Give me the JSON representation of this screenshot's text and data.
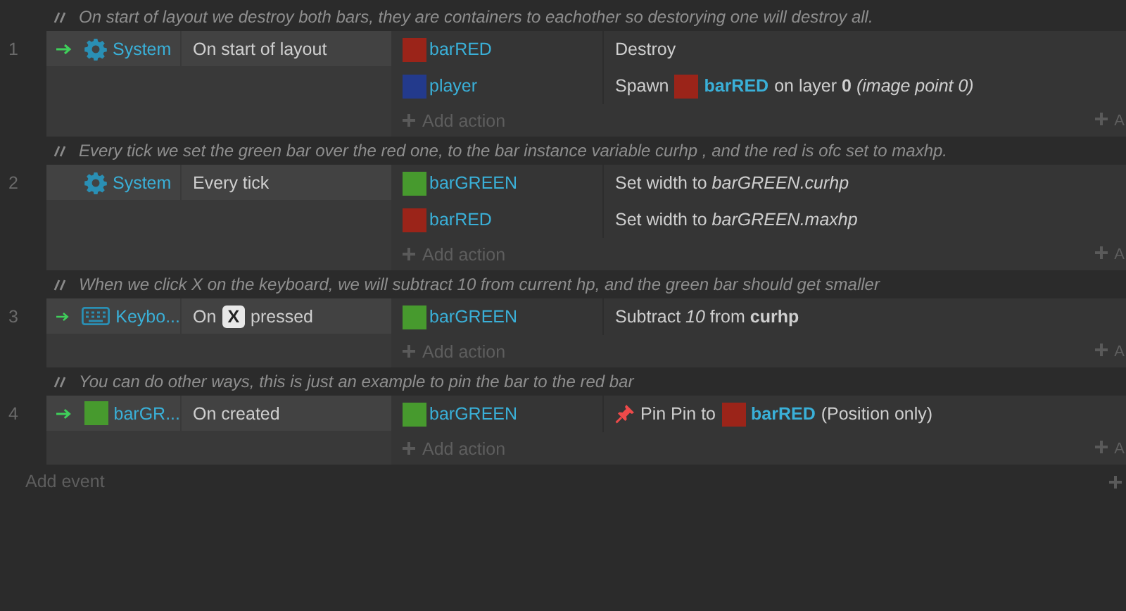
{
  "events": [
    {
      "number": "1",
      "comment": "On start of layout we destroy both bars, they are containers to eachother so destorying one will destroy all.",
      "condition": {
        "trigger": true,
        "object": {
          "kind": "system",
          "name": "System"
        },
        "parts": [
          {
            "kind": "text",
            "text": "On start of layout"
          }
        ]
      },
      "actions": [
        {
          "kind": "plain",
          "object": {
            "name": "barRED",
            "color": "#9b2419"
          },
          "parts": [
            {
              "kind": "text",
              "text": "Destroy"
            }
          ]
        },
        {
          "kind": "plain",
          "object": {
            "name": "player",
            "color": "#233a8c"
          },
          "parts": [
            {
              "kind": "text",
              "text": "Spawn"
            },
            {
              "kind": "object",
              "name": "barRED",
              "color": "#9b2419"
            },
            {
              "kind": "text",
              "text": "on layer **0** *(image point 0)*"
            }
          ]
        }
      ],
      "add_action": "Add action",
      "add_action_cut": "A"
    },
    {
      "number": "2",
      "comment": "Every tick we set the green bar over the red one, to the bar instance variable curhp , and the red is ofc set to maxhp.",
      "condition": {
        "trigger": false,
        "object": {
          "kind": "system",
          "name": "System"
        },
        "parts": [
          {
            "kind": "text",
            "text": "Every tick"
          }
        ]
      },
      "actions": [
        {
          "kind": "plain",
          "object": {
            "name": "barGREEN",
            "color": "#479a2e"
          },
          "parts": [
            {
              "kind": "text",
              "text": "Set width to *barGREEN.curhp*"
            }
          ]
        },
        {
          "kind": "plain",
          "object": {
            "name": "barRED",
            "color": "#9b2419"
          },
          "parts": [
            {
              "kind": "text",
              "text": "Set width to *barGREEN.maxhp*"
            }
          ]
        }
      ],
      "add_action": "Add action",
      "add_action_cut": "A"
    },
    {
      "number": "3",
      "comment": "When we click X on the keyboard, we will subtract 10 from current hp, and the green bar should get smaller",
      "condition": {
        "trigger": true,
        "object": {
          "kind": "keyboard",
          "name": "Keybo..."
        },
        "parts": [
          {
            "kind": "text",
            "text": "On"
          },
          {
            "kind": "key",
            "text": "X"
          },
          {
            "kind": "text",
            "text": "pressed"
          }
        ]
      },
      "actions": [
        {
          "kind": "plain",
          "object": {
            "name": "barGREEN",
            "color": "#479a2e"
          },
          "parts": [
            {
              "kind": "text",
              "text": "Subtract *10* from **curhp**"
            }
          ]
        }
      ],
      "add_action": "Add action",
      "add_action_cut": "A"
    },
    {
      "number": "4",
      "comment": "You can do other ways, this is just an example to pin the bar to the red bar",
      "condition": {
        "trigger": true,
        "object": {
          "kind": "sprite",
          "name": "barGR...",
          "color": "#479a2e"
        },
        "parts": [
          {
            "kind": "text",
            "text": "On created"
          }
        ]
      },
      "actions": [
        {
          "kind": "behavior",
          "object": {
            "name": "barGREEN",
            "color": "#479a2e"
          },
          "parts": [
            {
              "kind": "text",
              "text": "Pin Pin to"
            },
            {
              "kind": "object",
              "name": "barRED",
              "color": "#9b2419"
            },
            {
              "kind": "text",
              "text": "(Position only)"
            }
          ]
        }
      ],
      "add_action": "Add action",
      "add_action_cut": "A"
    }
  ],
  "add_event": "Add event"
}
